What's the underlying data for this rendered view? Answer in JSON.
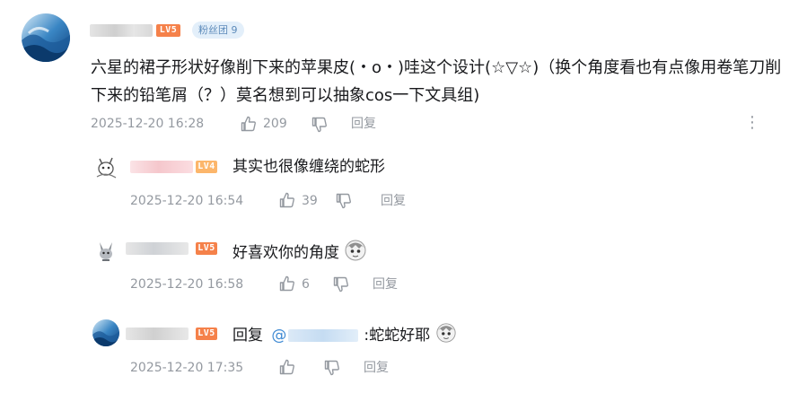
{
  "main_comment": {
    "level": "LV5",
    "fan_badge": "粉丝团 9",
    "text": "六星的裙子形状好像削下来的苹果皮(・o・)哇这个设计(☆▽☆)（换个角度看也有点像用卷笔刀削下来的铅笔屑（？）莫名想到可以抽象cos一下文具组)",
    "time": "2025-12-20 16:28",
    "likes": "209",
    "reply_label": "回复",
    "more_label": "⋮"
  },
  "replies": [
    {
      "level": "LV4",
      "text": "其实也很像缠绕的蛇形",
      "time": "2025-12-20 16:54",
      "likes": "39",
      "reply_label": "回复"
    },
    {
      "level": "LV5",
      "text": "好喜欢你的角度",
      "time": "2025-12-20 16:58",
      "likes": "6",
      "reply_label": "回复"
    },
    {
      "level": "LV5",
      "reply_prefix": "回复",
      "mention": "@",
      "text": ":蛇蛇好耶",
      "time": "2025-12-20 17:35",
      "likes": "",
      "reply_label": "回复"
    }
  ],
  "colors": {
    "lv5": "#f5814a",
    "lv4": "#fcb66b",
    "meta": "#9499a0",
    "mention": "#3f8ad3"
  }
}
